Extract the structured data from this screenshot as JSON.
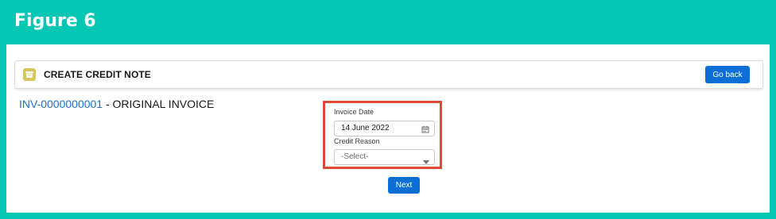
{
  "figure": {
    "title": "Figure 6"
  },
  "header": {
    "title": "CREATE CREDIT NOTE",
    "go_back_label": "Go back",
    "icon": "note-icon"
  },
  "invoice": {
    "link_text": "INV-0000000001",
    "suffix": " - ORIGINAL INVOICE"
  },
  "form": {
    "invoice_date_label": "Invoice Date",
    "invoice_date_value": "14 June 2022",
    "credit_reason_label": "Credit Reason",
    "credit_reason_value": "-Select-",
    "next_label": "Next"
  },
  "colors": {
    "teal": "#05c7b4",
    "brand_blue": "#0b6fd6",
    "highlight_red": "#e04932",
    "icon_yellow": "#d6c75a"
  }
}
